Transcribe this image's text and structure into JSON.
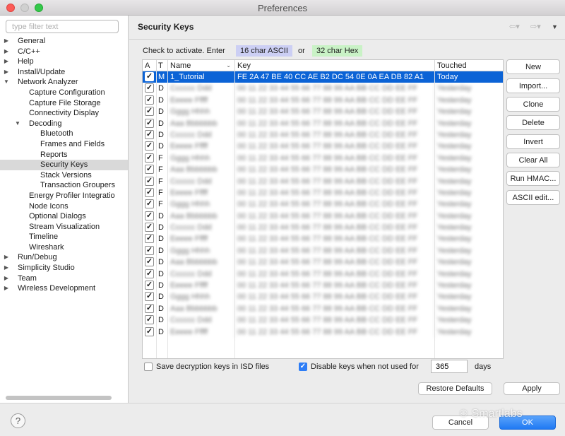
{
  "window": {
    "title": "Preferences"
  },
  "filter": {
    "placeholder": "type filter text"
  },
  "tree": [
    {
      "label": "General",
      "level": 0,
      "twisty": "▶"
    },
    {
      "label": "C/C++",
      "level": 0,
      "twisty": "▶"
    },
    {
      "label": "Help",
      "level": 0,
      "twisty": "▶"
    },
    {
      "label": "Install/Update",
      "level": 0,
      "twisty": "▶"
    },
    {
      "label": "Network Analyzer",
      "level": 0,
      "twisty": "▼"
    },
    {
      "label": "Capture Configuration",
      "level": 1,
      "twisty": ""
    },
    {
      "label": "Capture File Storage",
      "level": 1,
      "twisty": ""
    },
    {
      "label": "Connectivity Display",
      "level": 1,
      "twisty": ""
    },
    {
      "label": "Decoding",
      "level": 1,
      "twisty": "▼"
    },
    {
      "label": "Bluetooth",
      "level": 2,
      "twisty": ""
    },
    {
      "label": "Frames and Fields",
      "level": 2,
      "twisty": ""
    },
    {
      "label": "Reports",
      "level": 2,
      "twisty": ""
    },
    {
      "label": "Security Keys",
      "level": 2,
      "twisty": "",
      "selected": true
    },
    {
      "label": "Stack Versions",
      "level": 2,
      "twisty": ""
    },
    {
      "label": "Transaction Groupers",
      "level": 2,
      "twisty": ""
    },
    {
      "label": "Energy Profiler Integratio",
      "level": 1,
      "twisty": ""
    },
    {
      "label": "Node Icons",
      "level": 1,
      "twisty": ""
    },
    {
      "label": "Optional Dialogs",
      "level": 1,
      "twisty": ""
    },
    {
      "label": "Stream Visualization",
      "level": 1,
      "twisty": ""
    },
    {
      "label": "Timeline",
      "level": 1,
      "twisty": ""
    },
    {
      "label": "Wireshark",
      "level": 1,
      "twisty": ""
    },
    {
      "label": "Run/Debug",
      "level": 0,
      "twisty": "▶"
    },
    {
      "label": "Simplicity Studio",
      "level": 0,
      "twisty": "▶"
    },
    {
      "label": "Team",
      "level": 0,
      "twisty": "▶"
    },
    {
      "label": "Wireless Development",
      "level": 0,
      "twisty": "▶"
    }
  ],
  "page": {
    "title": "Security Keys",
    "hint_prefix": "Check to activate. Enter",
    "ascii_chip": "16 char ASCII",
    "or": "or",
    "hex_chip": "32 char Hex"
  },
  "nav_icons": [
    "back-arrow-icon",
    "forward-arrow-icon",
    "view-menu-icon"
  ],
  "table": {
    "columns": [
      "A",
      "T",
      "Name",
      "Key",
      "Touched"
    ],
    "rows": [
      {
        "checked": true,
        "type": "M",
        "name": "1_Tutorial",
        "key": "FE 2A 47 BE 40 CC AE B2 DC 54 0E 0A EA DB 82 A1",
        "touched": "Today",
        "selected": true
      },
      {
        "checked": true,
        "type": "D",
        "name": "",
        "key": "",
        "touched": ""
      },
      {
        "checked": true,
        "type": "D",
        "name": "",
        "key": "",
        "touched": ""
      },
      {
        "checked": true,
        "type": "D",
        "name": "",
        "key": "",
        "touched": ""
      },
      {
        "checked": true,
        "type": "D",
        "name": "",
        "key": "",
        "touched": ""
      },
      {
        "checked": true,
        "type": "D",
        "name": "",
        "key": "",
        "touched": ""
      },
      {
        "checked": true,
        "type": "D",
        "name": "",
        "key": "",
        "touched": ""
      },
      {
        "checked": true,
        "type": "F",
        "name": "",
        "key": "",
        "touched": ""
      },
      {
        "checked": true,
        "type": "F",
        "name": "",
        "key": "",
        "touched": ""
      },
      {
        "checked": true,
        "type": "F",
        "name": "",
        "key": "",
        "touched": ""
      },
      {
        "checked": true,
        "type": "F",
        "name": "",
        "key": "",
        "touched": ""
      },
      {
        "checked": true,
        "type": "F",
        "name": "",
        "key": "",
        "touched": ""
      },
      {
        "checked": true,
        "type": "D",
        "name": "",
        "key": "",
        "touched": ""
      },
      {
        "checked": true,
        "type": "D",
        "name": "",
        "key": "",
        "touched": ""
      },
      {
        "checked": true,
        "type": "D",
        "name": "",
        "key": "",
        "touched": ""
      },
      {
        "checked": true,
        "type": "D",
        "name": "",
        "key": "",
        "touched": ""
      },
      {
        "checked": true,
        "type": "D",
        "name": "",
        "key": "",
        "touched": ""
      },
      {
        "checked": true,
        "type": "D",
        "name": "",
        "key": "",
        "touched": ""
      },
      {
        "checked": true,
        "type": "D",
        "name": "",
        "key": "",
        "touched": ""
      },
      {
        "checked": true,
        "type": "D",
        "name": "",
        "key": "",
        "touched": ""
      },
      {
        "checked": true,
        "type": "D",
        "name": "",
        "key": "",
        "touched": ""
      },
      {
        "checked": true,
        "type": "D",
        "name": "",
        "key": "",
        "touched": ""
      },
      {
        "checked": true,
        "type": "D",
        "name": "",
        "key": "",
        "touched": ""
      }
    ]
  },
  "side_buttons": [
    "New",
    "Import...",
    "Clone",
    "Delete",
    "Invert",
    "Clear All",
    "Run HMAC...",
    "ASCII edit..."
  ],
  "options": {
    "save_isd_label": "Save decryption keys in ISD files",
    "save_isd_checked": false,
    "disable_label": "Disable keys when not used for",
    "disable_checked": true,
    "days_value": "365",
    "days_unit": "days"
  },
  "footer": {
    "restore_defaults": "Restore Defaults",
    "apply": "Apply",
    "help": "?",
    "cancel": "Cancel",
    "ok": "OK"
  },
  "watermark": {
    "text": "Smartlabs"
  },
  "colors": {
    "selection": "#0b63d6",
    "ascii_chip": "#cccff4",
    "hex_chip": "#c9f2c6",
    "ok_button": "#1f79f3"
  }
}
